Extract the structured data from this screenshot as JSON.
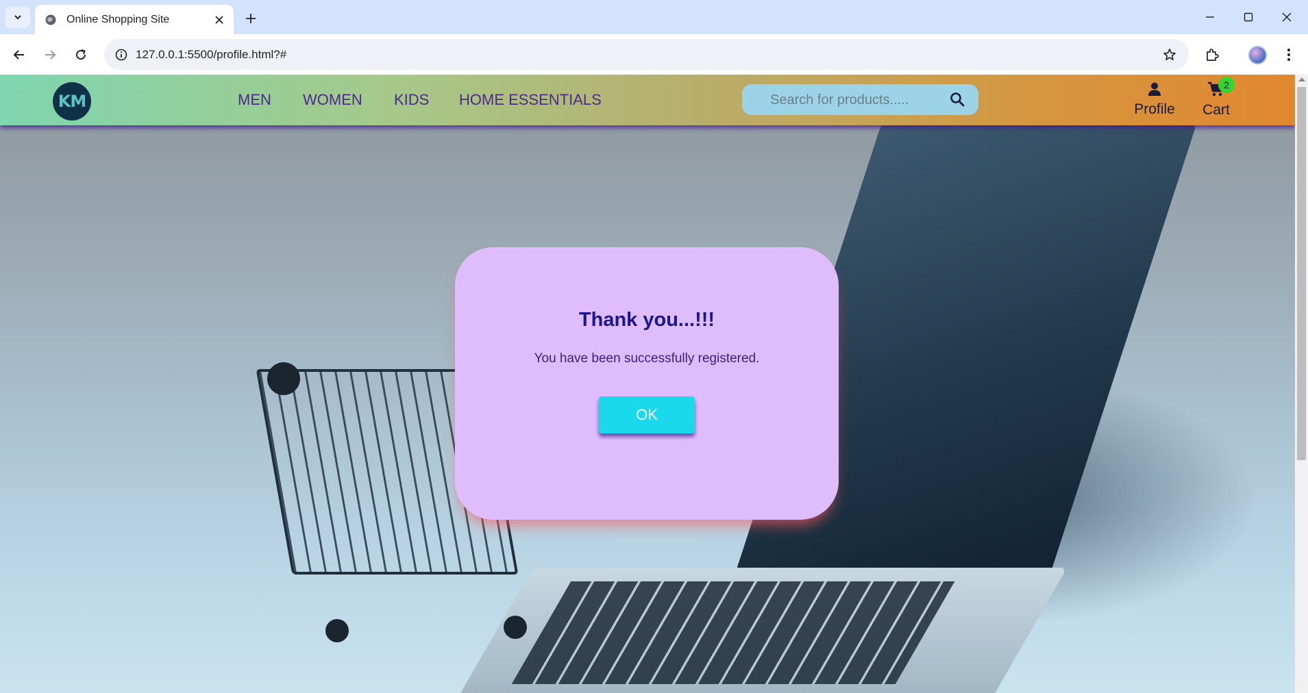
{
  "browser": {
    "tab_title": "Online Shopping Site",
    "url": "127.0.0.1:5500/profile.html?#"
  },
  "site": {
    "logo_text": "KM",
    "nav": [
      "MEN",
      "WOMEN",
      "KIDS",
      "HOME ESSENTIALS"
    ],
    "search_placeholder": "Search for products.....",
    "profile_label": "Profile",
    "cart_label": "Cart",
    "cart_count": "2"
  },
  "modal": {
    "title": "Thank you...!!!",
    "message": "You have been successfully registered.",
    "ok_label": "OK"
  },
  "colors": {
    "modal_bg": "#dfbdfc",
    "ok_button": "#1ad9ec",
    "nav_text": "#4b2a8c",
    "badge": "#35d42e"
  }
}
